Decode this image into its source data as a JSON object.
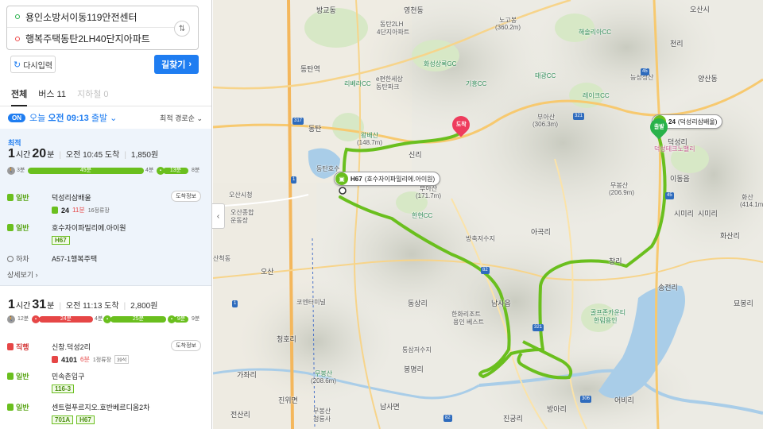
{
  "search": {
    "origin": "용인소방서이동119안전센터",
    "destination": "행복주택동탄2LH40단지아파트",
    "swap_icon": "⇅",
    "reset_label": "다시입력",
    "find_label": "길찾기"
  },
  "tabs": [
    {
      "label": "전체"
    },
    {
      "label": "버스 11"
    },
    {
      "label": "지하철 0"
    }
  ],
  "departure": {
    "on": "ON",
    "prefix": "오늘",
    "time": "오전 09:13",
    "suffix": "출발",
    "sort": "최적 경로순"
  },
  "option1": {
    "tag": "최적",
    "hours": "1",
    "hours_unit": "시간",
    "mins": "20",
    "mins_unit": "분",
    "arrival": "오전 10:45 도착",
    "fare": "1,850원",
    "bar": {
      "walk1": "3분",
      "seg1": "45분",
      "walk2": "4분",
      "seg2": "13분",
      "walk3": "8분"
    },
    "legs": [
      {
        "type": "일반",
        "stop": "덕성리삼배울",
        "info_btn": "도착정보",
        "bus": "24",
        "wait": "11분",
        "stops": "16정류장"
      },
      {
        "type": "일반",
        "stop": "호수자이파밀리에.아이원",
        "route": "H67"
      },
      {
        "type": "하차",
        "stop": "A57-1행복주택"
      }
    ],
    "more": "상세보기"
  },
  "option2": {
    "hours": "1",
    "hours_unit": "시간",
    "mins": "31",
    "mins_unit": "분",
    "arrival": "오전 11:13 도착",
    "fare": "2,800원",
    "bar": {
      "walk1": "12분",
      "seg1": "24분",
      "walk2": "4분",
      "seg2": "25분",
      "seg3": "9분",
      "walk3": "9분"
    },
    "legs": [
      {
        "type": "직행",
        "stop": "신창.덕성2리",
        "info_btn": "도착정보",
        "bus": "4101",
        "wait": "6분",
        "stops": "1정류장",
        "seats": "39석"
      },
      {
        "type": "일반",
        "stop": "민속촌입구",
        "route": "116-3"
      },
      {
        "type": "일반",
        "stop": "센트럴푸르지오.호반베르디움2차",
        "routes": [
          "701A",
          "H67"
        ]
      }
    ]
  },
  "map": {
    "callout_bus": "H67",
    "callout_stop": "(호수자이파밀리에.아이원)",
    "start_bus": "24",
    "start_stop": "(덕성리삼배울)",
    "dest_pin": "도착",
    "start_pin": "출발",
    "labels": [
      "영천동",
      "동탄2LH",
      "4단지아파트",
      "화성상록GC",
      "방교동",
      "동탄역",
      "리베라CC",
      "e편한세상",
      "동탄파크",
      "동탄",
      "왕배산",
      "(148.7m)",
      "신리",
      "동탄호수",
      "오산시청",
      "오산종합",
      "운동장",
      "산척동",
      "오산",
      "코엔터미널",
      "청호리",
      "가좌리",
      "무봉산",
      "(208.6m)",
      "진위면",
      "전산리",
      "무봉산",
      "청룡사",
      "남사면",
      "봉명리",
      "통삼저수지",
      "동상리",
      "한화리조트",
      "용인 베스트",
      "남사읍",
      "방축저수지",
      "아곡리",
      "한현CC",
      "부아산",
      "(171.7m)",
      "기흥CC",
      "태광CC",
      "노고봉",
      "(360.2m)",
      "해솔리아CC",
      "레이크CC",
      "부아산",
      "(306.3m)",
      "무봉산",
      "(206.9m)",
      "창리",
      "덕성리",
      "이동읍",
      "화산",
      "(414.1m)",
      "시미리",
      "천리",
      "골프존카운티",
      "한림용인",
      "어비리",
      "진궁리",
      "송전리",
      "화산리",
      "묘봉리",
      "오산시",
      "양산동",
      "방아리",
      "능성정산",
      "덕성테크노밸리",
      "시미리"
    ],
    "roads": [
      "317",
      "1",
      "82",
      "321",
      "321",
      "45",
      "45",
      "306",
      "82",
      "1"
    ]
  },
  "colors": {
    "accent": "#1f7df1",
    "route": "#6abf1e",
    "express": "#e64646",
    "dest": "#ee3c5d",
    "start": "#29b24a"
  }
}
